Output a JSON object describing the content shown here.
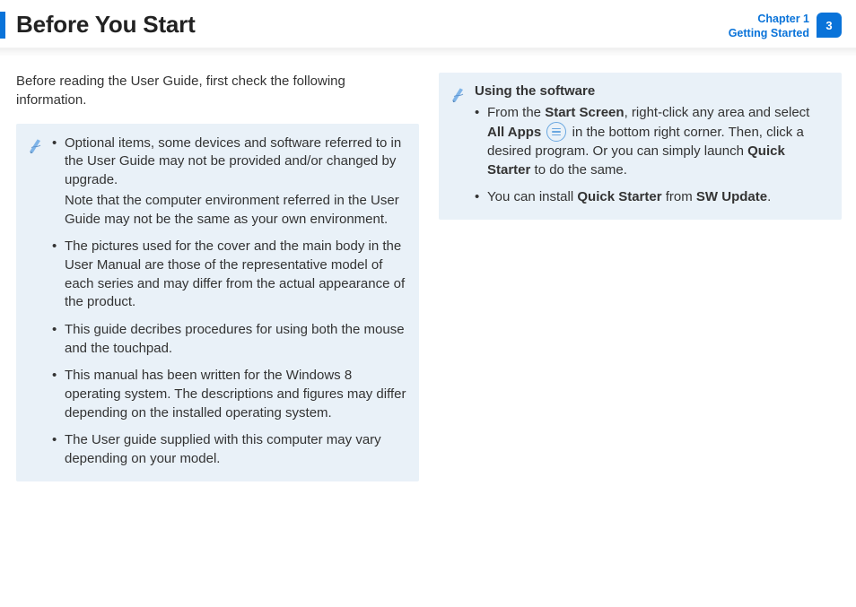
{
  "header": {
    "title": "Before You Start",
    "chapter_label": "Chapter 1",
    "section_label": "Getting Started",
    "page_number": "3"
  },
  "intro": "Before reading the User Guide, first check the following information.",
  "left_note": {
    "items": [
      {
        "text": "Optional items, some devices and software referred to in the User Guide may not be provided and/or changed by upgrade.",
        "sub": "Note that the computer environment referred in the User Guide may not be the same as your own environment."
      },
      {
        "text": "The pictures used for the cover and the main body in the User Manual are those of the representative model of each series and may differ from the actual appearance of the product."
      },
      {
        "text": "This guide decribes procedures for using both the mouse and the touchpad."
      },
      {
        "text": "This manual has been written for the Windows 8 operating system. The descriptions and figures may differ depending on the installed operating system."
      },
      {
        "text": "The User guide supplied with this computer may vary depending on your model."
      }
    ]
  },
  "right_note": {
    "title": "Using the software",
    "item1": {
      "pre": "From the ",
      "b1": "Start Screen",
      "mid1": ", right-click any area and select ",
      "b2": "All Apps",
      "mid2": " in the bottom right corner. Then, click a desired program. Or you can simply launch ",
      "b3": "Quick Starter",
      "post": " to do the same."
    },
    "item2": {
      "pre": "You can install ",
      "b1": "Quick Starter",
      "mid": " from ",
      "b2": "SW Update",
      "post": "."
    }
  }
}
